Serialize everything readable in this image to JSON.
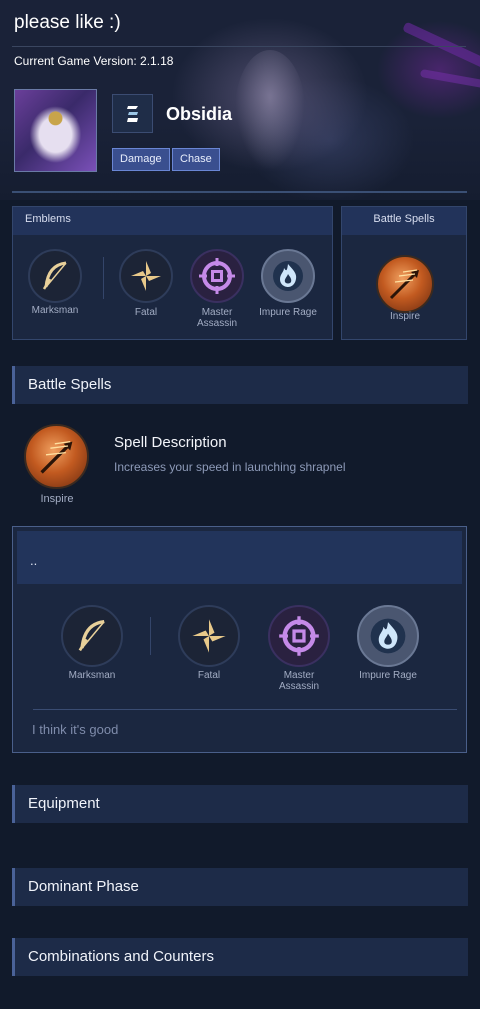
{
  "page": {
    "title": "please like :)",
    "version": "Current Game Version: 2.1.18"
  },
  "hero": {
    "name": "Obsidia",
    "role_icon": "marksman-role-icon",
    "tags": [
      "Damage",
      "Chase"
    ]
  },
  "emblems_panel": {
    "header": "Emblems",
    "items": [
      {
        "label": "Marksman",
        "icon": "bow-icon"
      },
      {
        "label": "Fatal",
        "icon": "fatal-spiral-icon"
      },
      {
        "label": "Master Assassin",
        "icon": "crosshair-icon"
      },
      {
        "label": "Impure Rage",
        "icon": "flame-icon"
      }
    ]
  },
  "spells_panel": {
    "header": "Battle Spells",
    "spell_label": "Inspire",
    "spell_icon": "inspire-icon"
  },
  "battle_spells_section": {
    "title": "Battle Spells",
    "spell_label": "Inspire",
    "spell_title": "Spell Description",
    "spell_description": "Increases your speed in launching shrapnel"
  },
  "build": {
    "header": "..",
    "items": [
      {
        "label": "Marksman",
        "icon": "bow-icon"
      },
      {
        "label": "Fatal",
        "icon": "fatal-spiral-icon"
      },
      {
        "label": "Master Assassin",
        "icon": "crosshair-icon"
      },
      {
        "label": "Impure Rage",
        "icon": "flame-icon"
      }
    ],
    "comment": "I think it's good"
  },
  "sections": [
    "Equipment",
    "Dominant Phase",
    "Combinations and Counters"
  ],
  "colors": {
    "background": "#111a2b",
    "panel": "#1b2740",
    "panel_header": "#22335a",
    "tag": "#3a4f8f",
    "accent": "#4a6298"
  }
}
